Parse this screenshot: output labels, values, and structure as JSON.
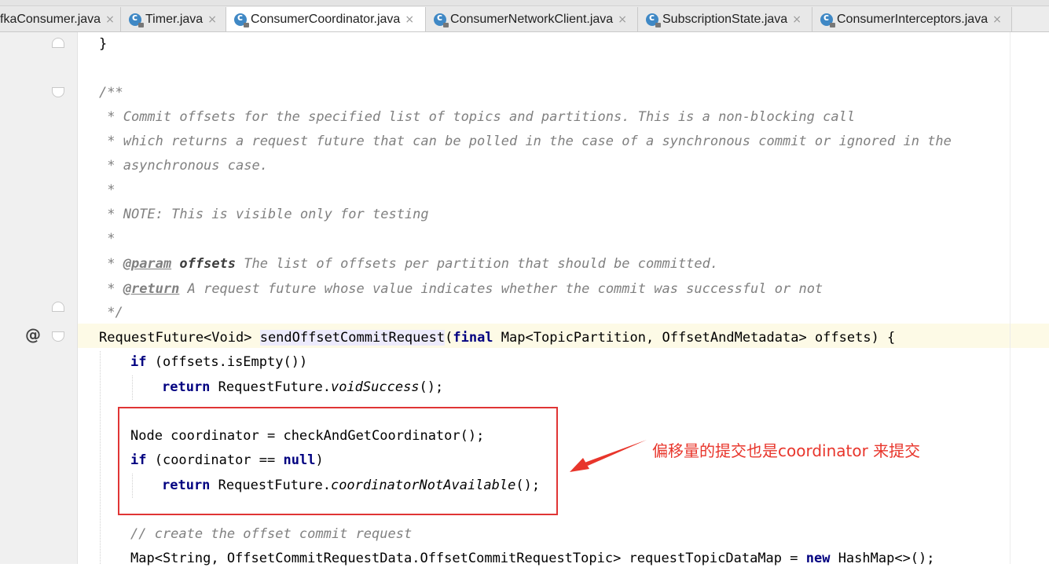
{
  "tabs": [
    {
      "label": "fkaConsumer.java",
      "active": false
    },
    {
      "label": "Timer.java",
      "active": false
    },
    {
      "label": "ConsumerCoordinator.java",
      "active": true
    },
    {
      "label": "ConsumerNetworkClient.java",
      "active": false
    },
    {
      "label": "SubscriptionState.java",
      "active": false
    },
    {
      "label": "ConsumerInterceptors.java",
      "active": false
    }
  ],
  "tab_close_glyph": "×",
  "gutter": {
    "override_marker": "@"
  },
  "code": {
    "l1": "}",
    "l2_open": "/**",
    "l3": " * Commit offsets for the specified list of topics and partitions. This is a non-blocking call",
    "l4": " * which returns a request future that can be polled in the case of a synchronous commit or ignored in the",
    "l5": " * asynchronous case.",
    "l6": " *",
    "l7": " * NOTE: This is visible only for testing",
    "l8": " *",
    "l9": {
      "star": " * ",
      "tag": "@param",
      "name": " offsets",
      "desc": " The list of offsets per partition that should be committed."
    },
    "l10": {
      "star": " * ",
      "tag": "@return",
      "desc": " A request future whose value indicates whether the commit was successful or not"
    },
    "l11": " */",
    "l12": {
      "type": "RequestFuture<Void> ",
      "method": "sendOffsetCommitRequest",
      "paren": "(",
      "kw_final": "final",
      "params": " Map<TopicPartition, OffsetAndMetadata> offsets) {"
    },
    "l13": {
      "kw": "if",
      "rest": " (offsets.isEmpty())"
    },
    "l14": {
      "kw": "return",
      "pre": " RequestFuture.",
      "call": "voidSuccess",
      "post": "();"
    },
    "l16": "Node coordinator = checkAndGetCoordinator();",
    "l17": {
      "kw": "if",
      "pre": " (coordinator == ",
      "null_kw": "null",
      "post": ")"
    },
    "l18": {
      "kw": "return",
      "pre": " RequestFuture.",
      "call": "coordinatorNotAvailable",
      "post": "();"
    },
    "l20": "// create the offset commit request",
    "l21": {
      "pre": "Map<String, OffsetCommitRequestData.OffsetCommitRequestTopic> requestTopicDataMap = ",
      "kw_new": "new",
      "post": " HashMap<>();"
    }
  },
  "annotation": {
    "text": "偏移量的提交也是coordinator 来提交",
    "color": "#e8352b"
  },
  "colors": {
    "keyword": "#000080",
    "comment": "#808080",
    "highlight_box": "#e03535",
    "current_line": "#fdfae6"
  }
}
